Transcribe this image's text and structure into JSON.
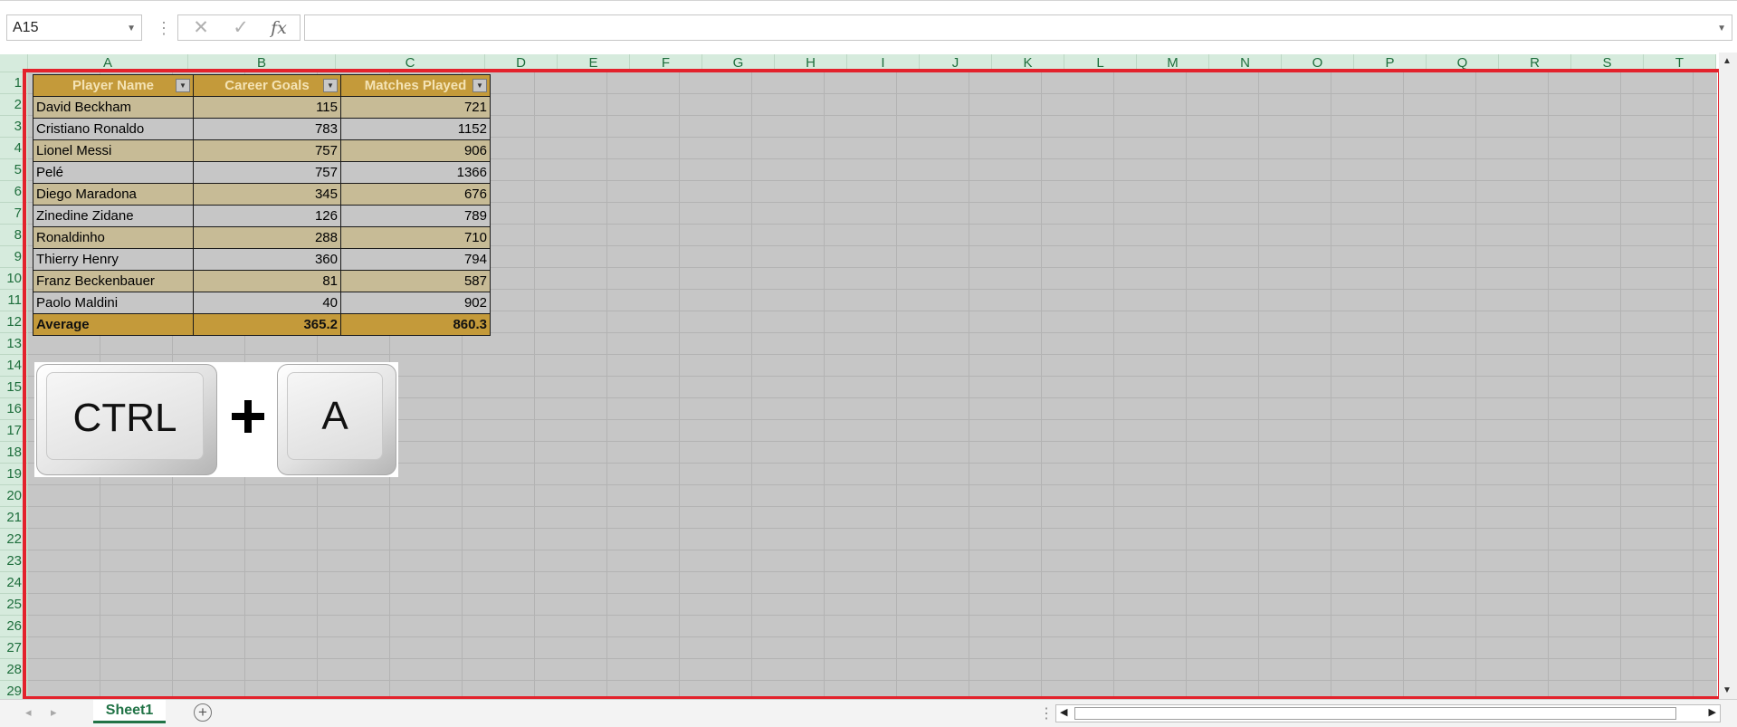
{
  "formula_bar": {
    "name_box": "A15",
    "separator": "⋮",
    "cancel_icon": "✕",
    "enter_icon": "✓",
    "function_label": "fx",
    "formula": ""
  },
  "columns": [
    "A",
    "B",
    "C",
    "D",
    "E",
    "F",
    "G",
    "H",
    "I",
    "J",
    "K",
    "L",
    "M",
    "N",
    "O",
    "P",
    "Q",
    "R",
    "S",
    "T"
  ],
  "rows": [
    "1",
    "2",
    "3",
    "4",
    "5",
    "6",
    "7",
    "8",
    "9",
    "10",
    "11",
    "12",
    "13",
    "14",
    "15",
    "16",
    "17",
    "18",
    "19",
    "20",
    "21",
    "22",
    "23",
    "24",
    "25",
    "26",
    "27",
    "28",
    "29"
  ],
  "table": {
    "headers": [
      "Player Name",
      "Career Goals",
      "Matches Played"
    ],
    "rows": [
      [
        "David Beckham",
        "115",
        "721"
      ],
      [
        "Cristiano Ronaldo",
        "783",
        "1152"
      ],
      [
        "Lionel Messi",
        "757",
        "906"
      ],
      [
        "Pelé",
        "757",
        "1366"
      ],
      [
        "Diego Maradona",
        "345",
        "676"
      ],
      [
        "Zinedine Zidane",
        "126",
        "789"
      ],
      [
        "Ronaldinho",
        "288",
        "710"
      ],
      [
        "Thierry Henry",
        "360",
        "794"
      ],
      [
        "Franz Beckenbauer",
        "81",
        "587"
      ],
      [
        "Paolo Maldini",
        "40",
        "902"
      ]
    ],
    "total": [
      "Average",
      "365.2",
      "860.3"
    ]
  },
  "keyboard_image": {
    "key1": "CTRL",
    "key2": "A",
    "plus_icon": "plus-icon"
  },
  "sheet_tabs": {
    "active": "Sheet1",
    "add_icon": "+"
  },
  "colors": {
    "header_fill": "#c49a3a",
    "band_fill": "#c7bb96",
    "selection_frame": "#e3222c",
    "accent": "#217346"
  }
}
